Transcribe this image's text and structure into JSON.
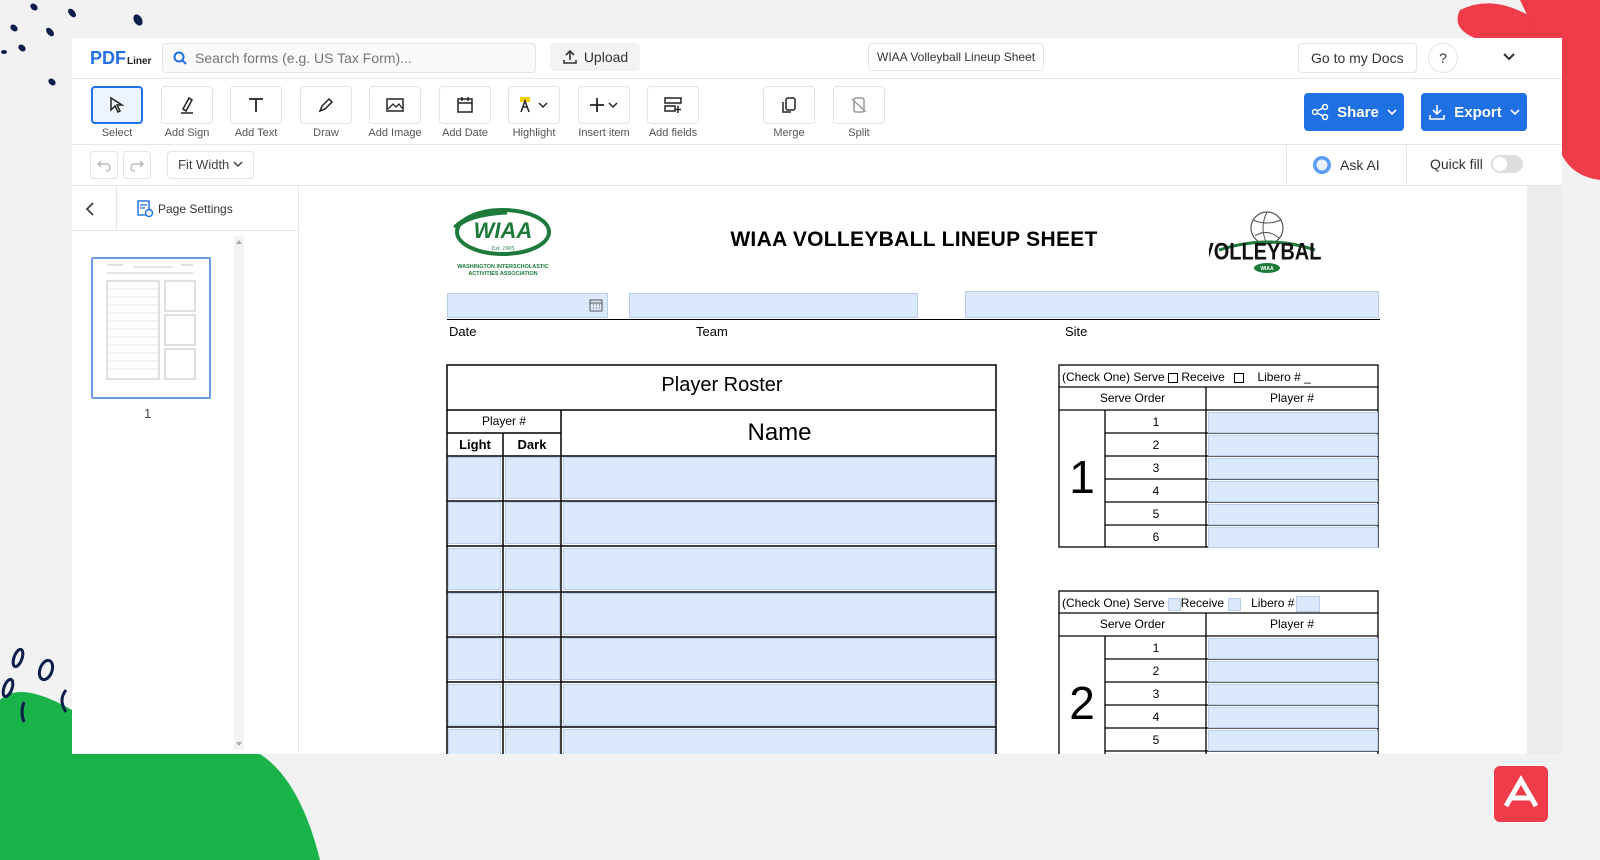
{
  "header": {
    "logo_main": "PDF",
    "logo_sub": "Liner",
    "search_placeholder": "Search forms (e.g. US Tax Form)...",
    "upload_label": "Upload",
    "doc_title": "WIAA Volleyball Lineup Sheet",
    "go_to_docs": "Go to my Docs",
    "help": "?"
  },
  "toolbar": {
    "tools": [
      "Select",
      "Add Sign",
      "Add Text",
      "Draw",
      "Add Image",
      "Add Date",
      "Highlight",
      "Insert item",
      "Add fields",
      "Merge",
      "Split"
    ],
    "share_label": "Share",
    "export_label": "Export"
  },
  "subbar": {
    "fit_width": "Fit Width",
    "ask_ai": "Ask AI",
    "quick_fill": "Quick fill"
  },
  "sidebar": {
    "page_settings": "Page Settings",
    "page_number": "1"
  },
  "document": {
    "title": "WIAA VOLLEYBALL LINEUP SHEET",
    "wiaa_logo_text": "WIAA",
    "wiaa_est": "Est. 1905",
    "wiaa_assoc_line1": "WASHINGTON INTERSCHOLASTIC",
    "wiaa_assoc_line2": "ACTIVITIES ASSOCIATION",
    "volleyball_logo_text": "VOLLEYBALL",
    "volleyball_logo_sub": "WIAA",
    "labels": {
      "date": "Date",
      "team": "Team",
      "site": "Site"
    },
    "roster": {
      "title": "Player Roster",
      "player_num": "Player #",
      "light": "Light",
      "dark": "Dark",
      "name": "Name"
    },
    "lineup1": {
      "check_one": "(Check One) Serve",
      "receive": "Receive",
      "libero": "Libero # _",
      "serve_order": "Serve Order",
      "player_num": "Player #",
      "set_number": "1",
      "rows": [
        "1",
        "2",
        "3",
        "4",
        "5",
        "6"
      ]
    },
    "lineup2": {
      "check_one": "(Check One) Serve",
      "receive": "Receive",
      "libero": "Libero #",
      "serve_order": "Serve Order",
      "player_num": "Player #",
      "set_number": "2",
      "rows": [
        "1",
        "2",
        "3",
        "4",
        "5"
      ]
    }
  },
  "colors": {
    "accent": "#1f6fe5",
    "field_fill": "#dce8fb",
    "wiaa_green": "#1d7a3a",
    "deco_red": "#ef3b4a",
    "deco_green": "#19b34a",
    "deco_navy": "#0c1f4a"
  }
}
